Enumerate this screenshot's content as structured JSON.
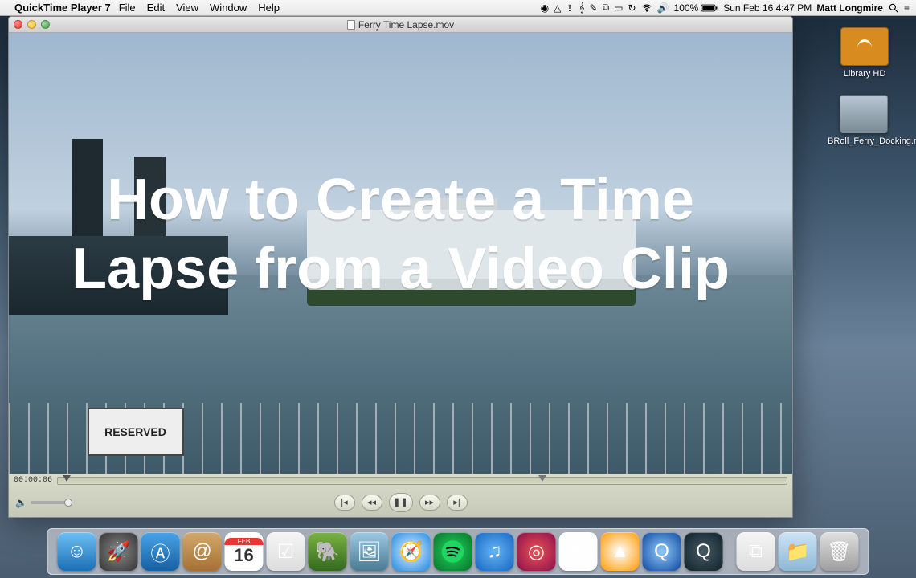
{
  "menubar": {
    "app_name": "QuickTime Player 7",
    "menus": [
      "File",
      "Edit",
      "View",
      "Window",
      "Help"
    ],
    "battery_pct": "100%",
    "battery_icon_state": "charging",
    "clock": "Sun Feb 16  4:47 PM",
    "user": "Matt Longmire"
  },
  "window": {
    "title": "Ferry Time Lapse.mov",
    "overlay_line": "How to Create a Time Lapse from a Video Clip",
    "sign_text": "RESERVED",
    "timecode": "00:00:06"
  },
  "desktop": {
    "hd_label": "Library HD",
    "file_label": "BRoll_Ferry_Docking.mov"
  },
  "dock": {
    "calendar_month": "FEB",
    "calendar_day": "16",
    "apps": [
      "finder",
      "launchpad",
      "appstore",
      "contacts",
      "calendar",
      "reminders",
      "evernote",
      "preview",
      "safari",
      "spotify",
      "itunes",
      "photobooth",
      "textedit",
      "vlc",
      "qt7",
      "qtx"
    ],
    "right": [
      "dropbox",
      "folder",
      "trash"
    ]
  }
}
